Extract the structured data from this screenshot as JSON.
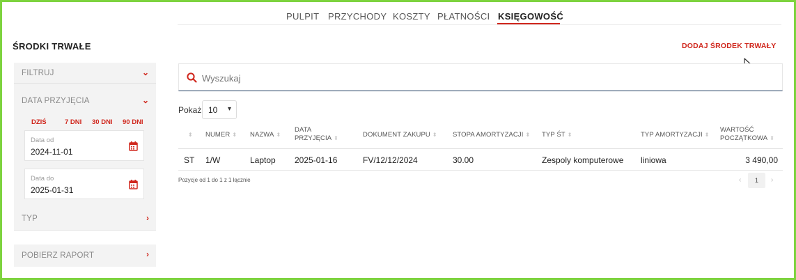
{
  "nav": {
    "items": [
      "PULPIT",
      "PRZYCHODY",
      "KOSZTY",
      "PŁATNOŚCI",
      "KSIĘGOWOŚĆ"
    ],
    "active": "KSIĘGOWOŚĆ"
  },
  "page": {
    "title": "ŚRODKI TRWAŁE",
    "add_label": "DODAJ ŚRODEK TRWAŁY"
  },
  "sidebar": {
    "filter_label": "FILTRUJ",
    "date_label": "DATA PRZYJĘCIA",
    "quick": [
      "DZIŚ",
      "7 DNI",
      "30 DNI",
      "90 DNI"
    ],
    "date_from": {
      "label": "Data od",
      "value": "2024-11-01"
    },
    "date_to": {
      "label": "Data do",
      "value": "2025-01-31"
    },
    "type_label": "TYP",
    "report_label": "POBIERZ RAPORT"
  },
  "search": {
    "placeholder": "Wyszukaj"
  },
  "table": {
    "show_label": "Pokaż",
    "page_size": "10",
    "columns": [
      "",
      "NUMER",
      "NAZWA",
      "DATA PRZYJĘCIA",
      "DOKUMENT ZAKUPU",
      "STOPA AMORTYZACJI",
      "TYP ŚT",
      "TYP AMORTYZACJI",
      "WARTOŚĆ POCZĄTKOWA"
    ],
    "column_lines": {
      "data_przyjecia": [
        "DATA",
        "PRZYJĘCIA"
      ],
      "wartosc": [
        "WARTOŚĆ",
        "POCZĄTKOWA"
      ]
    },
    "rows": [
      [
        "ST",
        "1/W",
        "Laptop",
        "2025-01-16",
        "FV/12/12/2024",
        "30.00",
        "Zespoly komputerowe",
        "liniowa",
        "3 490,00"
      ]
    ],
    "info": "Pozycje od 1 do 1 z 1 łącznie",
    "current_page": "1"
  },
  "colors": {
    "accent": "#d0271d",
    "search_border": "#1d3a5f",
    "frame": "#7ed33f"
  },
  "icons": {
    "search": "search-icon",
    "calendar": "calendar-icon",
    "chevron_down": "chevron-down-icon",
    "chevron_right": "chevron-right-icon",
    "cursor": "mouse-cursor-icon"
  }
}
